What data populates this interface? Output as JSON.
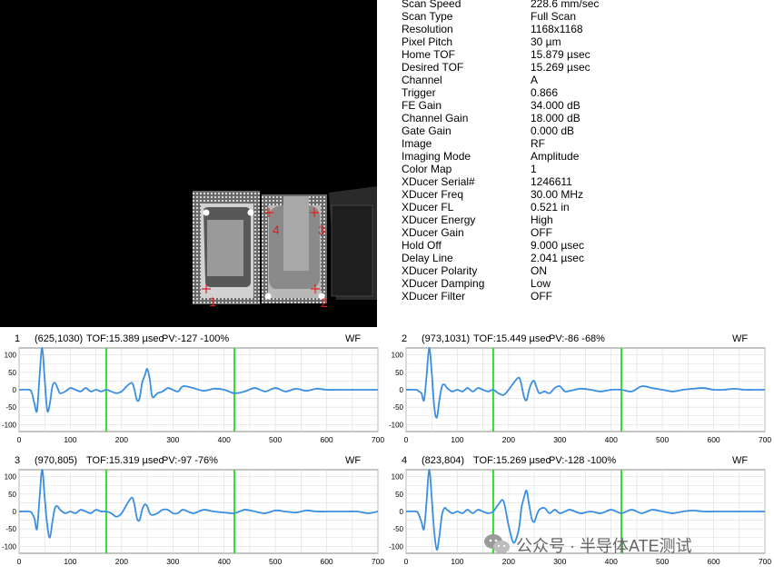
{
  "parameters": [
    {
      "label": "Scan Speed",
      "value": "228.6 mm/sec"
    },
    {
      "label": "Scan Type",
      "value": "Full Scan"
    },
    {
      "label": "Resolution",
      "value": "1168x1168"
    },
    {
      "label": "Pixel Pitch",
      "value": "30 µm"
    },
    {
      "label": "Home TOF",
      "value": "15.879 µsec"
    },
    {
      "label": "Desired TOF",
      "value": "15.269 µsec"
    },
    {
      "label": "Channel",
      "value": "A"
    },
    {
      "label": "Trigger",
      "value": "0.866"
    },
    {
      "label": "FE Gain",
      "value": "34.000 dB"
    },
    {
      "label": "Channel Gain",
      "value": "18.000 dB"
    },
    {
      "label": "Gate Gain",
      "value": "0.000 dB"
    },
    {
      "label": "Image",
      "value": "RF"
    },
    {
      "label": "Imaging Mode",
      "value": "Amplitude"
    },
    {
      "label": "Color Map",
      "value": "1"
    },
    {
      "label": "XDucer Serial#",
      "value": "1246611"
    },
    {
      "label": "XDucer Freq",
      "value": "30.00 MHz"
    },
    {
      "label": "XDucer FL",
      "value": "0.521 in"
    },
    {
      "label": "XDucer Energy",
      "value": "High"
    },
    {
      "label": "XDucer Gain",
      "value": "OFF"
    },
    {
      "label": "Hold Off",
      "value": "9.000 µsec"
    },
    {
      "label": "Delay Line",
      "value": "2.041 µsec"
    },
    {
      "label": "XDucer Polarity",
      "value": "ON"
    },
    {
      "label": "XDucer Damping",
      "value": "Low"
    },
    {
      "label": "XDucer Filter",
      "value": "OFF"
    }
  ],
  "scan": {
    "markers": [
      "1",
      "2",
      "3",
      "4"
    ]
  },
  "watermark": "公众号 · 半导体ATE测试",
  "colors": {
    "waveform": "#3a8fe0",
    "gate": "#33dd33",
    "marker": "#e02020",
    "grid": "#dcdcdc"
  },
  "panels": [
    {
      "id": "1",
      "coord": "(625,1030)",
      "tof": "TOF:15.389 µsec",
      "pv": "PV:-127  -100%",
      "mode": "WF"
    },
    {
      "id": "2",
      "coord": "(973,1031)",
      "tof": "TOF:15.449 µsec",
      "pv": "PV:-86  -68%",
      "mode": "WF"
    },
    {
      "id": "3",
      "coord": "(970,805)",
      "tof": "TOF:15.319 µsec",
      "pv": "PV:-97  -76%",
      "mode": "WF"
    },
    {
      "id": "4",
      "coord": "(823,804)",
      "tof": "TOF:15.269 µsec",
      "pv": "PV:-128  -100%",
      "mode": "WF"
    }
  ],
  "chart_data": [
    {
      "type": "line",
      "xlim": [
        0,
        700
      ],
      "ylim": [
        -120,
        120
      ],
      "xticks": [
        0,
        100,
        200,
        300,
        400,
        500,
        600,
        700
      ],
      "yticks": [
        100,
        50,
        0,
        -50,
        -100
      ],
      "gates": [
        170,
        420
      ],
      "x": [
        0,
        20,
        25,
        30,
        35,
        40,
        45,
        50,
        55,
        60,
        65,
        70,
        75,
        80,
        90,
        100,
        110,
        120,
        130,
        140,
        150,
        160,
        170,
        180,
        190,
        200,
        210,
        220,
        225,
        230,
        235,
        240,
        245,
        250,
        255,
        260,
        270,
        280,
        290,
        300,
        310,
        320,
        340,
        360,
        380,
        400,
        420,
        440,
        460,
        480,
        500,
        520,
        540,
        560,
        580,
        600,
        620,
        640,
        660,
        680,
        700
      ],
      "series": [
        {
          "values": [
            0,
            0,
            -10,
            -40,
            -60,
            40,
            120,
            30,
            -60,
            -40,
            10,
            20,
            5,
            -10,
            -5,
            5,
            0,
            -5,
            5,
            -5,
            0,
            -5,
            0,
            -5,
            -10,
            -5,
            10,
            20,
            0,
            -30,
            -25,
            20,
            40,
            60,
            30,
            -20,
            -10,
            -5,
            5,
            0,
            -5,
            10,
            5,
            -3,
            3,
            0,
            -10,
            -5,
            5,
            -5,
            5,
            -5,
            3,
            -3,
            3,
            0,
            0,
            0,
            0,
            0,
            0
          ]
        }
      ]
    },
    {
      "type": "line",
      "xlim": [
        0,
        700
      ],
      "ylim": [
        -120,
        120
      ],
      "xticks": [
        0,
        100,
        200,
        300,
        400,
        500,
        600,
        700
      ],
      "yticks": [
        100,
        50,
        0,
        -50,
        -100
      ],
      "gates": [
        170,
        420
      ],
      "x": [
        0,
        20,
        25,
        30,
        35,
        40,
        45,
        50,
        55,
        60,
        65,
        70,
        75,
        80,
        90,
        100,
        110,
        120,
        130,
        140,
        150,
        160,
        170,
        180,
        190,
        200,
        210,
        220,
        225,
        230,
        235,
        240,
        245,
        250,
        255,
        260,
        270,
        280,
        290,
        300,
        310,
        320,
        340,
        360,
        380,
        400,
        420,
        440,
        460,
        480,
        500,
        520,
        540,
        560,
        580,
        600,
        620,
        640,
        660,
        680,
        700
      ],
      "series": [
        {
          "values": [
            0,
            0,
            -5,
            -10,
            -30,
            40,
            120,
            50,
            -50,
            -80,
            -30,
            10,
            15,
            5,
            -5,
            0,
            -5,
            5,
            -5,
            5,
            0,
            -5,
            0,
            -10,
            -15,
            0,
            20,
            35,
            15,
            -20,
            -30,
            0,
            20,
            25,
            5,
            -10,
            -5,
            -10,
            5,
            10,
            -5,
            -3,
            3,
            0,
            -5,
            0,
            0,
            -5,
            10,
            5,
            0,
            -5,
            0,
            3,
            5,
            0,
            0,
            3,
            0,
            0,
            0
          ]
        }
      ]
    },
    {
      "type": "line",
      "xlim": [
        0,
        700
      ],
      "ylim": [
        -120,
        120
      ],
      "xticks": [
        0,
        100,
        200,
        300,
        400,
        500,
        600,
        700
      ],
      "yticks": [
        100,
        50,
        0,
        -50,
        -100
      ],
      "gates": [
        170,
        420
      ],
      "x": [
        0,
        20,
        25,
        30,
        35,
        40,
        45,
        50,
        55,
        60,
        65,
        70,
        75,
        80,
        90,
        100,
        110,
        120,
        130,
        140,
        150,
        160,
        170,
        180,
        190,
        200,
        210,
        220,
        225,
        230,
        235,
        240,
        245,
        250,
        255,
        260,
        270,
        280,
        290,
        300,
        310,
        320,
        340,
        360,
        380,
        400,
        420,
        440,
        460,
        480,
        500,
        520,
        540,
        560,
        580,
        600,
        620,
        640,
        660,
        680,
        700
      ],
      "series": [
        {
          "values": [
            0,
            0,
            -5,
            -20,
            -50,
            40,
            120,
            40,
            -40,
            -75,
            -30,
            10,
            15,
            5,
            -5,
            0,
            -5,
            5,
            0,
            -5,
            5,
            0,
            0,
            -5,
            -15,
            -5,
            20,
            40,
            20,
            -20,
            -25,
            5,
            20,
            15,
            -5,
            -10,
            -5,
            5,
            5,
            -5,
            -5,
            5,
            -5,
            5,
            0,
            -3,
            -5,
            5,
            0,
            -5,
            3,
            0,
            -3,
            3,
            0,
            0,
            0,
            0,
            0,
            -5,
            0
          ]
        }
      ]
    },
    {
      "type": "line",
      "xlim": [
        0,
        700
      ],
      "ylim": [
        -120,
        120
      ],
      "xticks": [
        0,
        100,
        200,
        300,
        400,
        500,
        600,
        700
      ],
      "yticks": [
        100,
        50,
        0,
        -50,
        -100
      ],
      "gates": [
        170,
        420
      ],
      "x": [
        0,
        20,
        25,
        30,
        35,
        40,
        45,
        50,
        55,
        60,
        65,
        70,
        75,
        80,
        90,
        100,
        110,
        120,
        130,
        140,
        150,
        160,
        170,
        180,
        190,
        200,
        210,
        220,
        225,
        230,
        235,
        240,
        245,
        250,
        255,
        260,
        270,
        280,
        290,
        300,
        310,
        320,
        340,
        360,
        380,
        400,
        420,
        440,
        460,
        480,
        500,
        520,
        540,
        560,
        580,
        600,
        620,
        640,
        660,
        680,
        700
      ],
      "series": [
        {
          "values": [
            0,
            0,
            -10,
            -30,
            -50,
            30,
            120,
            40,
            -60,
            -110,
            -70,
            -10,
            10,
            5,
            -5,
            0,
            -5,
            5,
            -5,
            5,
            0,
            -5,
            0,
            20,
            30,
            -40,
            -90,
            -50,
            10,
            40,
            60,
            20,
            -20,
            -30,
            -10,
            5,
            10,
            -5,
            5,
            -5,
            0,
            5,
            -5,
            0,
            -5,
            5,
            -5,
            5,
            -5,
            5,
            0,
            -5,
            0,
            3,
            0,
            0,
            0,
            0,
            0,
            0,
            0
          ]
        }
      ]
    }
  ]
}
